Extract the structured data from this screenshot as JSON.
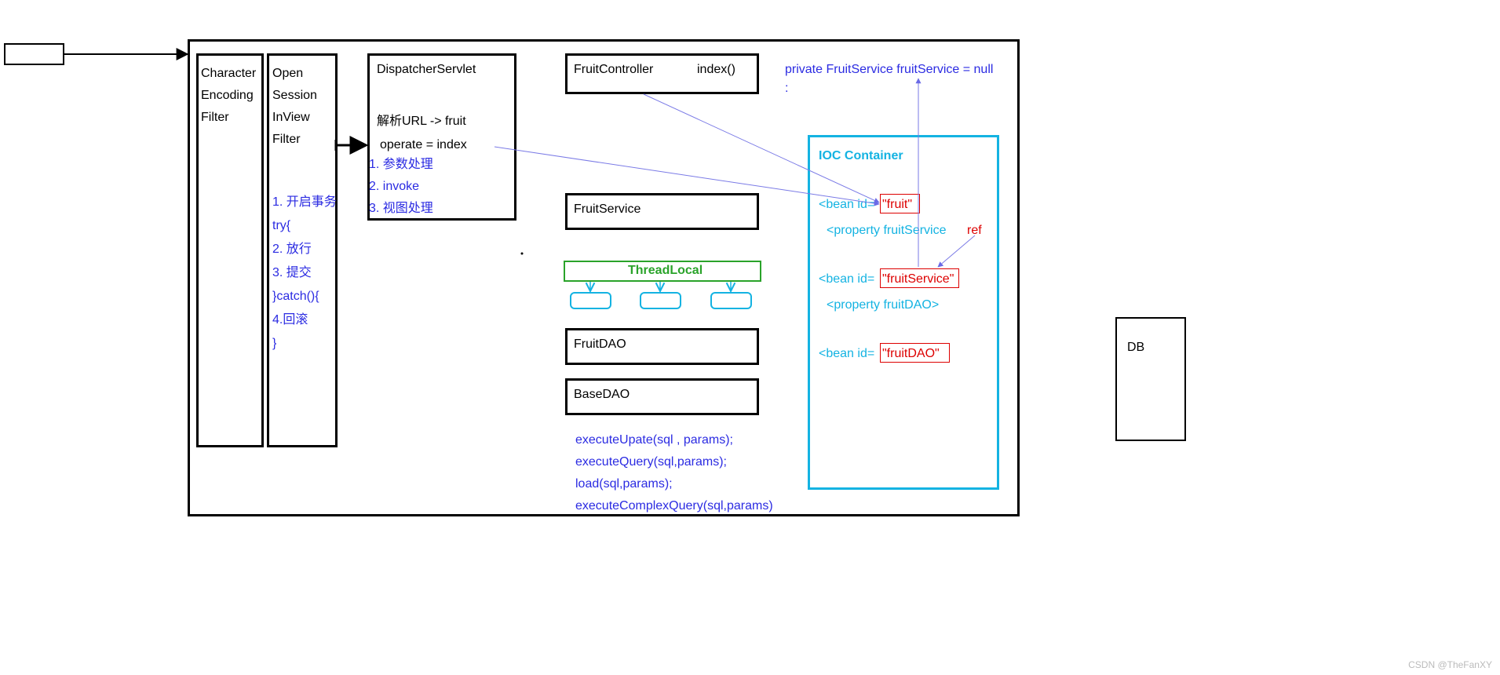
{
  "entry_box": "",
  "filters": {
    "char_encoding": "Character\nEncoding\nFilter",
    "session_view": "Open\nSession\nInView\nFilter",
    "tx_steps": "1. 开启事务\ntry{\n2. 放行\n3. 提交\n}catch(){\n4.回滚\n}"
  },
  "dispatcher": {
    "title": "DispatcherServlet",
    "line1": "解析URL -> fruit",
    "line2": "operate = index",
    "steps": "1. 参数处理\n2. invoke\n3. 视图处理"
  },
  "controller": {
    "title": "FruitController",
    "method": "index()"
  },
  "declaration": "private FruitService fruitService = null\n:",
  "fruit_service": "FruitService",
  "thread_local": "ThreadLocal",
  "fruit_dao": "FruitDAO",
  "base_dao": "BaseDAO",
  "dao_methods": "executeUpate(sql , params);\nexecuteQuery(sql,params);\nload(sql,params);\nexecuteComplexQuery(sql,params)",
  "ioc": {
    "title": "IOC Container",
    "bean1_prefix": "<bean id=",
    "bean1_id": "\"fruit\"",
    "bean1_prop": "<property fruitService",
    "bean1_ref": "ref",
    "bean2_prefix": "<bean id=",
    "bean2_id": "\"fruitService\"",
    "bean2_prop": "<property fruitDAO>",
    "bean3_prefix": "<bean id=",
    "bean3_id": "\"fruitDAO\""
  },
  "db": "DB",
  "watermark": "CSDN @TheFanXY"
}
